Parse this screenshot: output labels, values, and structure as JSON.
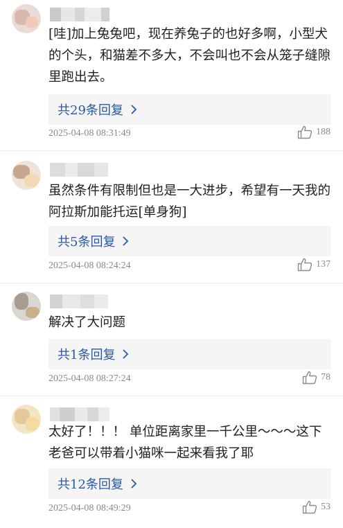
{
  "comments": [
    {
      "text": "[哇]加上兔兔吧，现在养兔子的也好多啊，小型犬的个头，和猫差不多大，不会叫也不会从笼子缝隙里跑出去。",
      "replies_label": "共29条回复",
      "time": "2025-04-08 08:31:49",
      "likes": "188",
      "avatar_icon": "avatar-icon"
    },
    {
      "text": "虽然条件有限制但也是一大进步，希望有一天我的阿拉斯加能托运[单身狗]",
      "replies_label": "共5条回复",
      "time": "2025-04-08 08:24:24",
      "likes": "137",
      "avatar_icon": "avatar-icon"
    },
    {
      "text": "解决了大问题",
      "replies_label": "共1条回复",
      "time": "2025-04-08 08:27:24",
      "likes": "78",
      "avatar_icon": "avatar-icon"
    },
    {
      "text": "太好了！！！ 单位距离家里一千公里～～～这下老爸可以带着小猫咪一起来看我了耶",
      "replies_label": "共12条回复",
      "time": "2025-04-08 08:49:29",
      "likes": "53",
      "avatar_icon": "avatar-icon"
    }
  ],
  "colors": {
    "reply_link": "#2b57a5",
    "reply_bg": "#f5f5f5",
    "meta_text": "#8a8a8a"
  },
  "icons": {
    "like": "thumbs-up-icon",
    "chevron": "chevron-right-icon"
  }
}
